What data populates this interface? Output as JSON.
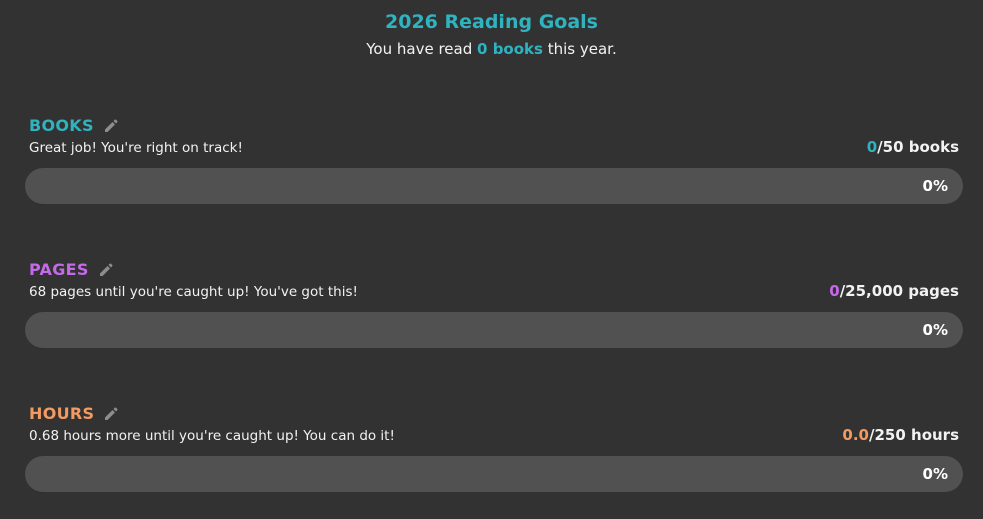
{
  "header": {
    "title": "2026 Reading Goals",
    "sub_prefix": "You have read",
    "sub_highlight": "0 books",
    "sub_suffix": "this year."
  },
  "colors": {
    "background": "#323232",
    "track": "#515151",
    "books": "#2fb3c0",
    "pages": "#c46ae8",
    "hours": "#f29a62",
    "text": "#f2f2f2"
  },
  "goals": [
    {
      "name": "BOOKS",
      "message": "Great job! You're right on track!",
      "current": "0",
      "target": "/50 books",
      "percent_label": "0%",
      "progress": 0,
      "color": "#2fb3c0",
      "edit_icon": "pencil-icon"
    },
    {
      "name": "PAGES",
      "message": "68 pages until you're caught up! You've got this!",
      "current": "0",
      "target": "/25,000 pages",
      "percent_label": "0%",
      "progress": 0,
      "color": "#c46ae8",
      "edit_icon": "pencil-icon"
    },
    {
      "name": "HOURS",
      "message": "0.68 hours more until you're caught up! You can do it!",
      "current": "0.0",
      "target": "/250 hours",
      "percent_label": "0%",
      "progress": 0,
      "color": "#f29a62",
      "edit_icon": "pencil-icon"
    }
  ]
}
